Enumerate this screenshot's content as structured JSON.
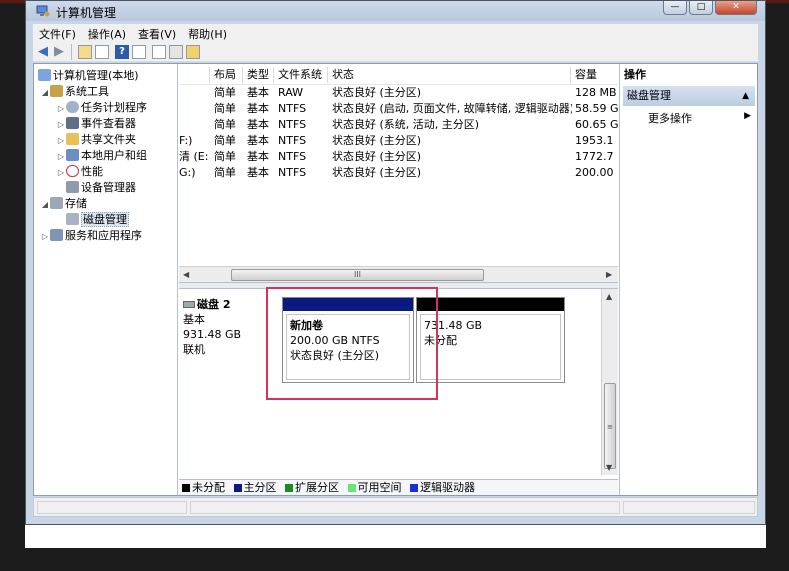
{
  "window": {
    "title": "计算机管理"
  },
  "menu": [
    "文件(F)",
    "操作(A)",
    "查看(V)",
    "帮助(H)"
  ],
  "tree": [
    {
      "label": "计算机管理(本地)",
      "level": 0,
      "twisty": "",
      "icon": "computer-icon"
    },
    {
      "label": "系统工具",
      "level": 1,
      "twisty": "◢",
      "icon": "tools-icon"
    },
    {
      "label": "任务计划程序",
      "level": 2,
      "twisty": "▷",
      "icon": "clock-icon"
    },
    {
      "label": "事件查看器",
      "level": 2,
      "twisty": "▷",
      "icon": "event-viewer-icon"
    },
    {
      "label": "共享文件夹",
      "level": 2,
      "twisty": "▷",
      "icon": "shared-folder-icon"
    },
    {
      "label": "本地用户和组",
      "level": 2,
      "twisty": "▷",
      "icon": "users-icon"
    },
    {
      "label": "性能",
      "level": 2,
      "twisty": "▷",
      "icon": "performance-icon"
    },
    {
      "label": "设备管理器",
      "level": 2,
      "twisty": "",
      "icon": "device-manager-icon"
    },
    {
      "label": "存储",
      "level": 1,
      "twisty": "◢",
      "icon": "storage-icon"
    },
    {
      "label": "磁盘管理",
      "level": 2,
      "twisty": "",
      "icon": "disk-management-icon",
      "selected": true
    },
    {
      "label": "服务和应用程序",
      "level": 1,
      "twisty": "▷",
      "icon": "services-icon"
    }
  ],
  "volume_columns": [
    "布局",
    "类型",
    "文件系统",
    "状态",
    "容量"
  ],
  "volumes": [
    {
      "name": "",
      "layout": "简单",
      "type": "基本",
      "fs": "RAW",
      "status": "状态良好 (主分区)",
      "capacity": "128 MB"
    },
    {
      "name": "",
      "layout": "简单",
      "type": "基本",
      "fs": "NTFS",
      "status": "状态良好 (启动, 页面文件, 故障转储, 逻辑驱动器)",
      "capacity": "58.59 G"
    },
    {
      "name": "",
      "layout": "简单",
      "type": "基本",
      "fs": "NTFS",
      "status": "状态良好 (系统, 活动, 主分区)",
      "capacity": "60.65 G"
    },
    {
      "name": "F:)",
      "layout": "简单",
      "type": "基本",
      "fs": "NTFS",
      "status": "状态良好 (主分区)",
      "capacity": "1953.1"
    },
    {
      "name": "清 (E:)",
      "layout": "简单",
      "type": "基本",
      "fs": "NTFS",
      "status": "状态良好 (主分区)",
      "capacity": "1772.7"
    },
    {
      "name": "G:)",
      "layout": "简单",
      "type": "基本",
      "fs": "NTFS",
      "status": "状态良好 (主分区)",
      "capacity": "200.00"
    }
  ],
  "scroll_thumb_glyph": "III",
  "disk": {
    "name": "磁盘 2",
    "kind": "基本",
    "size": "931.48 GB",
    "state": "联机",
    "partitions": [
      {
        "name": "新加卷",
        "size": "200.00 GB NTFS",
        "status": "状态良好 (主分区)"
      },
      {
        "name": "",
        "size": "731.48 GB",
        "status": "未分配"
      }
    ]
  },
  "legend": [
    {
      "label": "未分配",
      "color": "#000000"
    },
    {
      "label": "主分区",
      "color": "#0b1a80"
    },
    {
      "label": "扩展分区",
      "color": "#1c8a1c"
    },
    {
      "label": "可用空间",
      "color": "#6ee36e"
    },
    {
      "label": "逻辑驱动器",
      "color": "#1a2fd0"
    }
  ],
  "actions": {
    "header": "操作",
    "section": "磁盘管理",
    "more": "更多操作"
  }
}
